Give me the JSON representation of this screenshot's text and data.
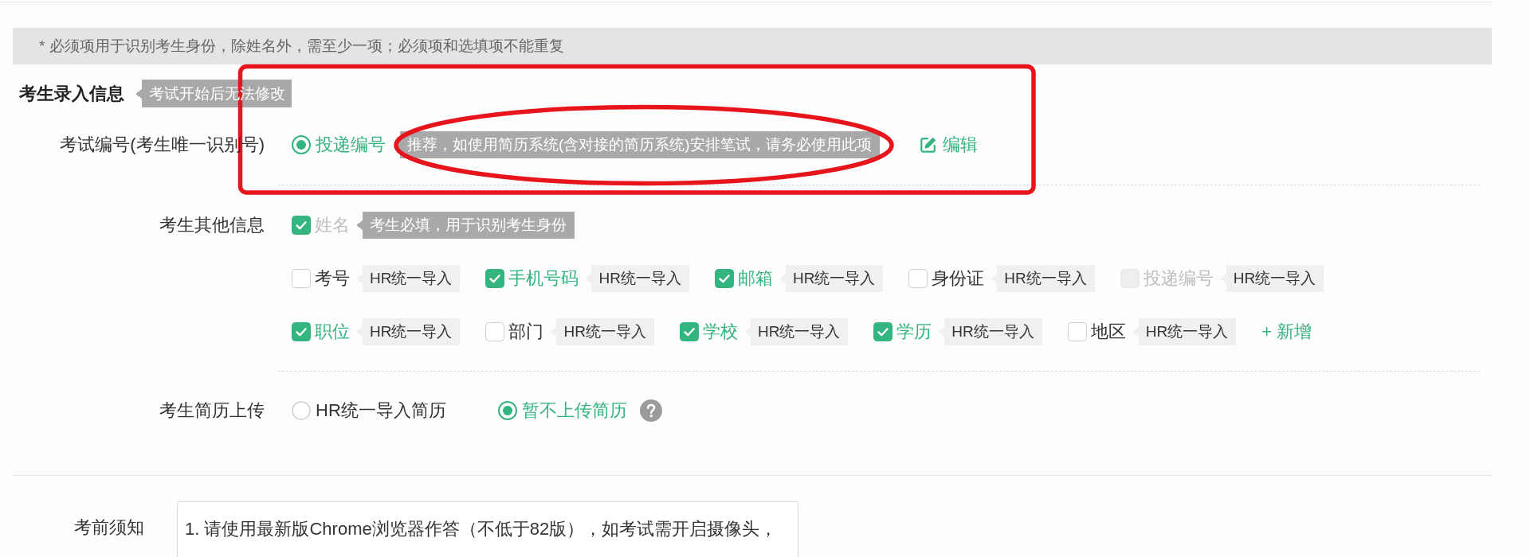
{
  "notice": "* 必须项用于识别考生身份，除姓名外，需至少一项；必须项和选填项不能重复",
  "section": {
    "title": "考生录入信息",
    "badge": "考试开始后无法修改"
  },
  "exam_id": {
    "label": "考试编号(考生唯一识别号)",
    "options": [
      {
        "label": "投递编号",
        "selected": true,
        "hint": "推荐，如使用简历系统(含对接的简历系统)安排笔试，请务必使用此项"
      }
    ],
    "edit_link": "编辑"
  },
  "other_info": {
    "label": "考生其他信息",
    "required": {
      "label": "姓名",
      "checked": true,
      "disabled": true,
      "hint": "考生必填，用于识别考生身份"
    },
    "field_rows": [
      {
        "fields": [
          {
            "label": "考号",
            "checked": false,
            "disabled": false,
            "tag": "HR统一导入"
          },
          {
            "label": "手机号码",
            "checked": true,
            "disabled": false,
            "tag": "HR统一导入"
          },
          {
            "label": "邮箱",
            "checked": true,
            "disabled": false,
            "tag": "HR统一导入"
          },
          {
            "label": "身份证",
            "checked": false,
            "disabled": false,
            "tag": "HR统一导入"
          },
          {
            "label": "投递编号",
            "checked": false,
            "disabled": true,
            "tag": "HR统一导入"
          }
        ]
      },
      {
        "fields": [
          {
            "label": "职位",
            "checked": true,
            "disabled": false,
            "tag": "HR统一导入"
          },
          {
            "label": "部门",
            "checked": false,
            "disabled": false,
            "tag": "HR统一导入"
          },
          {
            "label": "学校",
            "checked": true,
            "disabled": false,
            "tag": "HR统一导入"
          },
          {
            "label": "学历",
            "checked": true,
            "disabled": false,
            "tag": "HR统一导入"
          },
          {
            "label": "地区",
            "checked": false,
            "disabled": false,
            "tag": "HR统一导入"
          }
        ]
      }
    ],
    "add_link": "+ 新增"
  },
  "resume_upload": {
    "label": "考生简历上传",
    "options": [
      {
        "label": "HR统一导入简历",
        "selected": false
      },
      {
        "label": "暂不上传简历",
        "selected": true
      }
    ]
  },
  "exam_notice": {
    "label": "考前须知",
    "value": "1. 请使用最新版Chrome浏览器作答（不低于82版），如考试需开启摄像头，"
  },
  "annotations": [
    {
      "kind": "rectangle"
    },
    {
      "kind": "ellipse"
    }
  ]
}
